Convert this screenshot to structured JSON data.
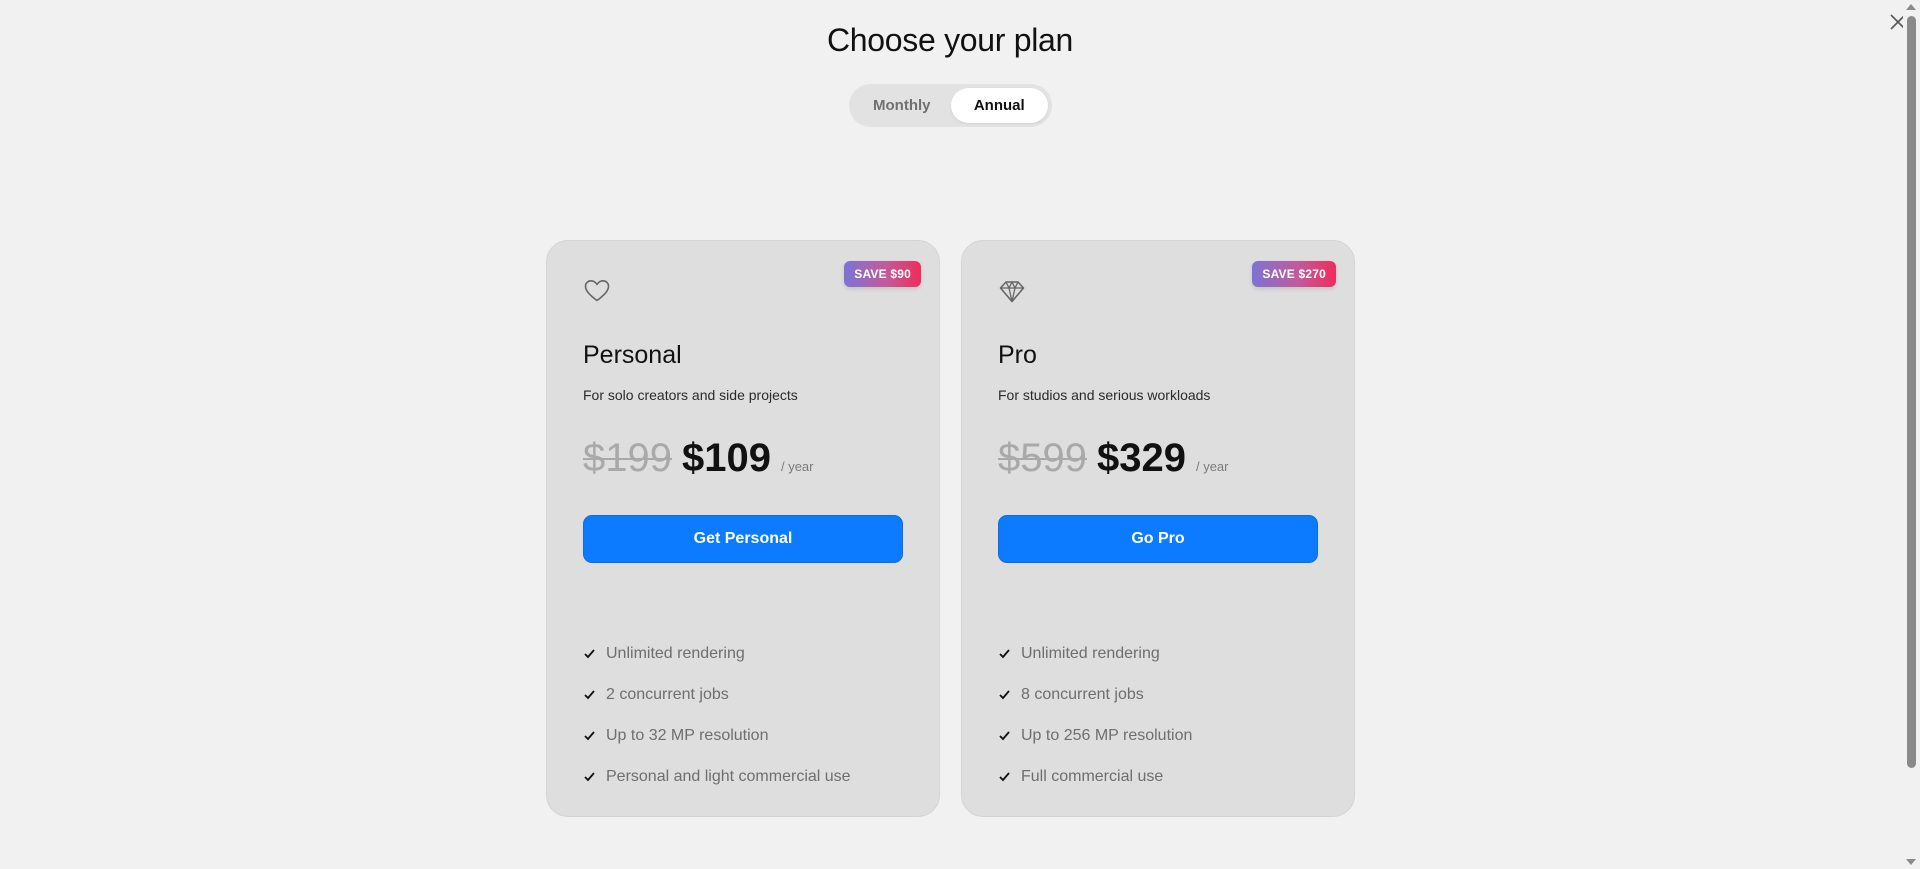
{
  "header": {
    "title": "Choose your plan"
  },
  "billing_toggle": {
    "options": [
      "Monthly",
      "Annual"
    ],
    "selected": "Annual"
  },
  "plans": [
    {
      "icon": "heart-icon",
      "badge": "SAVE $90",
      "name": "Personal",
      "description": "For solo creators and side projects",
      "old_price": "$199",
      "price": "$109",
      "period": "/ year",
      "cta": "Get Personal",
      "features": [
        "Unlimited rendering",
        "2 concurrent jobs",
        "Up to 32 MP resolution",
        "Personal and light commercial use"
      ]
    },
    {
      "icon": "diamond-icon",
      "badge": "SAVE $270",
      "name": "Pro",
      "description": "For studios and serious workloads",
      "old_price": "$599",
      "price": "$329",
      "period": "/ year",
      "cta": "Go Pro",
      "features": [
        "Unlimited rendering",
        "8 concurrent jobs",
        "Up to 256 MP resolution",
        "Full commercial use"
      ]
    }
  ],
  "colors": {
    "background": "#f1f1f1",
    "card": "#dedede",
    "accent": "#0d7bff",
    "badge_gradient_start": "#7b74d6",
    "badge_gradient_end": "#ef2c5b"
  }
}
